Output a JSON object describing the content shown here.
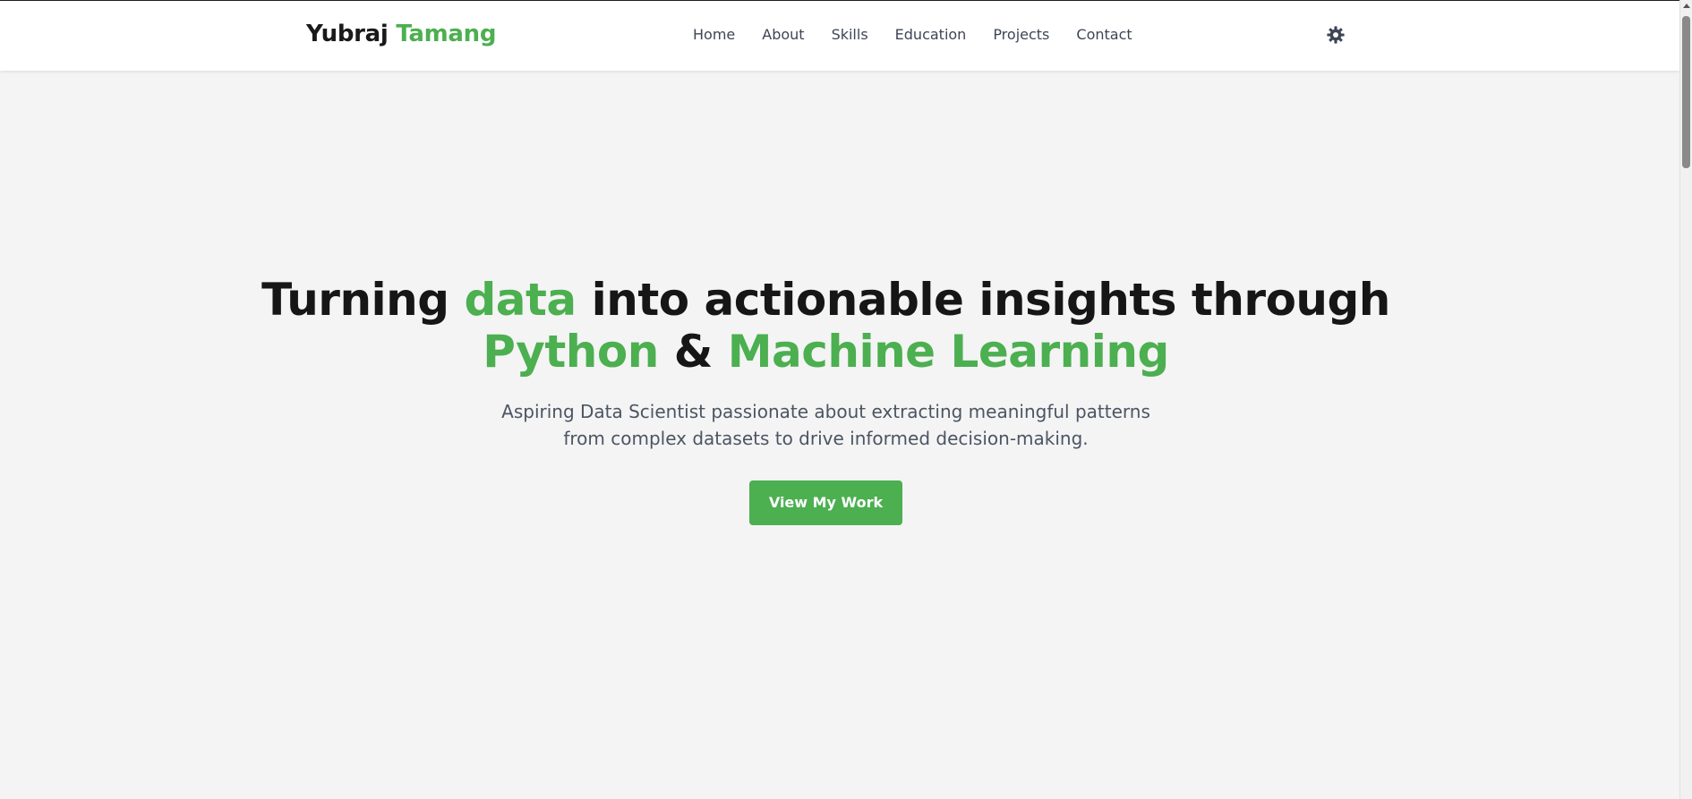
{
  "header": {
    "logo_first": "Yubraj",
    "logo_second": "Tamang",
    "nav": [
      {
        "label": "Home"
      },
      {
        "label": "About"
      },
      {
        "label": "Skills"
      },
      {
        "label": "Education"
      },
      {
        "label": "Projects"
      },
      {
        "label": "Contact"
      }
    ],
    "theme_toggle_icon": "gear-icon"
  },
  "hero": {
    "title_part1": "Turning ",
    "title_accent1": "data",
    "title_part2": " into actionable insights through",
    "title_accent2": "Python",
    "title_part3": " & ",
    "title_accent3": "Machine Learning",
    "subtitle_line1": "Aspiring Data Scientist passionate about extracting meaningful patterns",
    "subtitle_line2": "from complex datasets to drive informed decision-making.",
    "cta_label": "View My Work"
  },
  "colors": {
    "accent": "#4caf50",
    "text_dark": "#161616",
    "text_muted": "#4b5563",
    "background": "#f4f4f4"
  }
}
